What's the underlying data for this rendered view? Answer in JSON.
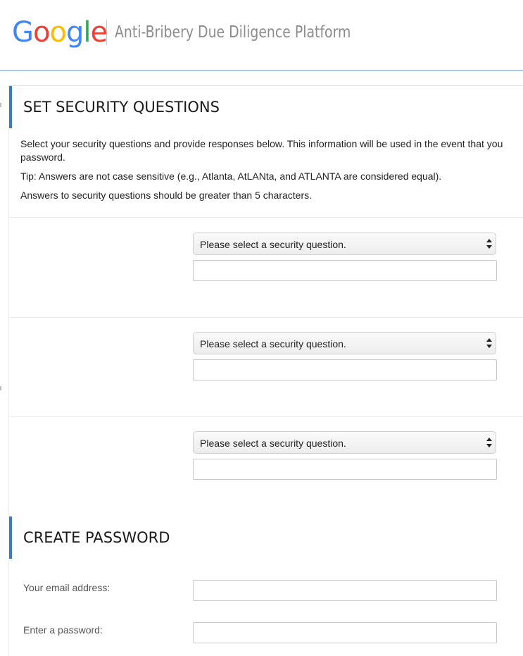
{
  "header": {
    "logo_letters": [
      "G",
      "o",
      "o",
      "g",
      "l",
      "e"
    ],
    "logo_colors": [
      "#4285f4",
      "#ea4335",
      "#fbbc05",
      "#4285f4",
      "#34a853",
      "#ea4335"
    ],
    "platform_title": "Anti-Bribery Due Diligence Platform"
  },
  "security_section": {
    "heading": "SET SECURITY QUESTIONS",
    "intro_line1": "Select your security questions and provide responses below. This information will be used in the event that you",
    "intro_line1_cont": "password.",
    "tip": "Tip: Answers are not case sensitive (e.g., Atlanta, AtLANta, and ATLANTA are considered equal).",
    "length_rule": "Answers to security questions should be greater than 5 characters.",
    "questions": [
      {
        "select_label": "Please select a security question.",
        "answer_value": ""
      },
      {
        "select_label": "Please select a security question.",
        "answer_value": ""
      },
      {
        "select_label": "Please select a security question.",
        "answer_value": ""
      }
    ]
  },
  "password_section": {
    "heading": "CREATE PASSWORD",
    "email_label": "Your email address:",
    "email_value": "",
    "password_label": "Enter a password:",
    "password_value": ""
  },
  "colors": {
    "accent_bar": "#3c78c3",
    "header_rule": "#7fa2d8"
  },
  "icons": {
    "select_arrows": "up-down-chevron-icon"
  }
}
